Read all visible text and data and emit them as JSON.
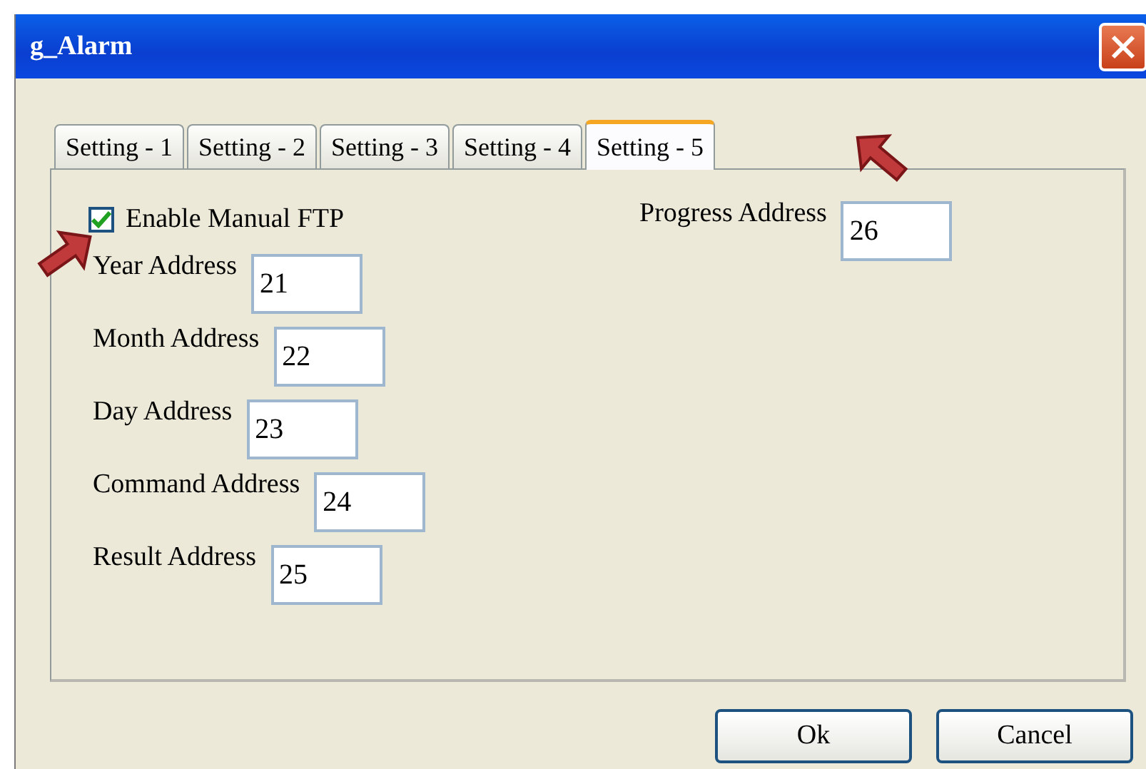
{
  "window": {
    "title": "g_Alarm"
  },
  "tabs": [
    {
      "label": "Setting - 1",
      "selected": false
    },
    {
      "label": "Setting - 2",
      "selected": false
    },
    {
      "label": "Setting - 3",
      "selected": false
    },
    {
      "label": "Setting - 4",
      "selected": false
    },
    {
      "label": "Setting - 5",
      "selected": true
    }
  ],
  "enable_manual_ftp": {
    "label": "Enable Manual FTP",
    "checked": true
  },
  "fields": [
    {
      "label": "Year Address",
      "value": "21"
    },
    {
      "label": "Month Address",
      "value": "22"
    },
    {
      "label": "Day Address",
      "value": "23"
    },
    {
      "label": "Command Address",
      "value": "24"
    },
    {
      "label": "Result Address",
      "value": "25"
    }
  ],
  "progress": {
    "label": "Progress Address",
    "value": "26"
  },
  "buttons": [
    "Ok",
    "Cancel"
  ]
}
